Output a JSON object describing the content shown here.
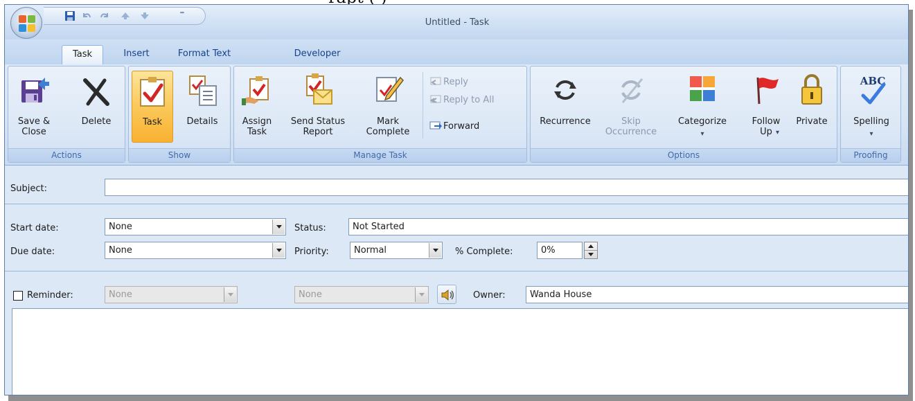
{
  "caption_fragment": "rapt (                                    )",
  "window": {
    "title": "Untitled - Task"
  },
  "quick_access": {
    "icons": [
      "save-icon",
      "undo-icon",
      "redo-icon",
      "previous-item-icon",
      "next-item-icon",
      "customize-qat-icon"
    ],
    "customize_glyph": "⁼"
  },
  "tabs": [
    {
      "label": "Task",
      "active": true
    },
    {
      "label": "Insert"
    },
    {
      "label": "Format Text"
    },
    {
      "label": "Developer"
    }
  ],
  "ribbon": {
    "actions": {
      "label": "Actions",
      "save_close": "Save &\nClose",
      "delete": "Delete"
    },
    "show": {
      "label": "Show",
      "task": "Task",
      "details": "Details"
    },
    "manage_task": {
      "label": "Manage Task",
      "assign_task": "Assign\nTask",
      "send_status_report": "Send Status\nReport",
      "mark_complete": "Mark\nComplete",
      "reply": "Reply",
      "reply_to_all": "Reply to All",
      "forward": "Forward"
    },
    "options": {
      "label": "Options",
      "recurrence": "Recurrence",
      "skip_occurrence": "Skip\nOccurrence",
      "categorize": "Categorize",
      "follow_up": "Follow\nUp",
      "private": "Private"
    },
    "proofing": {
      "label": "Proofing",
      "spelling": "Spelling",
      "spelling_glyph": "ABC"
    },
    "dropdown_arrow": "▾"
  },
  "form": {
    "subject_label": "Subject:",
    "subject_value": "",
    "start_date_label": "Start date:",
    "start_date_value": "None",
    "due_date_label": "Due date:",
    "due_date_value": "None",
    "status_label": "Status:",
    "status_value": "Not Started",
    "priority_label": "Priority:",
    "priority_value": "Normal",
    "percent_complete_label": "% Complete:",
    "percent_complete_value": "0%",
    "reminder_label": "Reminder:",
    "reminder_checked": false,
    "reminder_date_value": "None",
    "reminder_time_value": "None",
    "owner_label": "Owner:",
    "owner_value": "Wanda House",
    "notes_value": ""
  }
}
